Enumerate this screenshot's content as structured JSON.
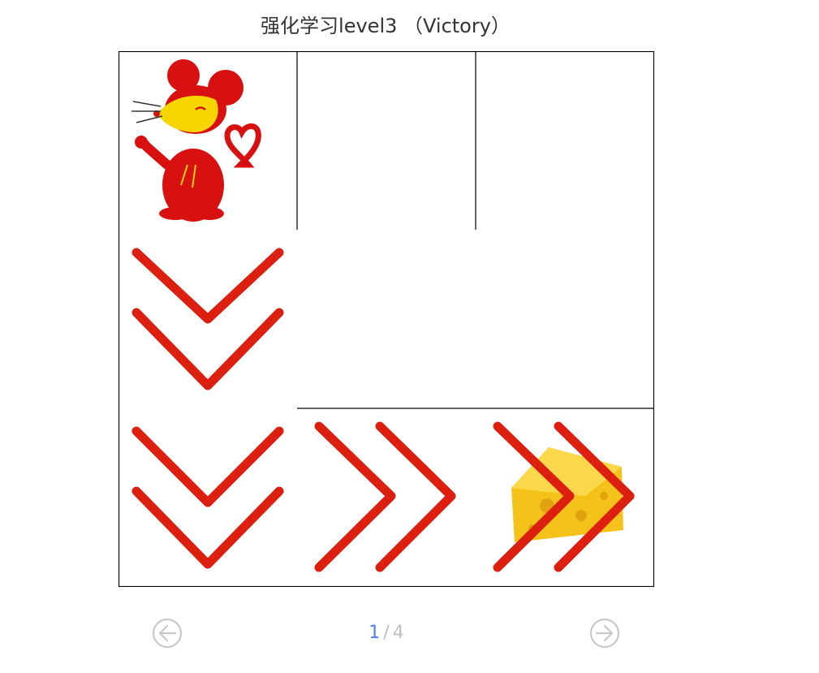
{
  "title": "强化学习level3 （Victory）",
  "board": {
    "rows": 3,
    "cols": 3,
    "cells": [
      {
        "row": 0,
        "col": 0,
        "content": "mouse"
      },
      {
        "row": 1,
        "col": 0,
        "content": "arrow-down"
      },
      {
        "row": 2,
        "col": 0,
        "content": "arrow-down"
      },
      {
        "row": 2,
        "col": 1,
        "content": "arrow-right"
      },
      {
        "row": 2,
        "col": 2,
        "content": "arrow-right",
        "extra": "cheese"
      }
    ],
    "colors": {
      "grid": "#000000",
      "arrow": "#dd1f10",
      "mouse": "#d81010",
      "mouse_face": "#f6d500",
      "cheese": "#f5c21a"
    }
  },
  "pager": {
    "current": "1",
    "separator": "/",
    "total": "4",
    "prev_icon": "arrow-left-circle-icon",
    "next_icon": "arrow-right-circle-icon"
  }
}
